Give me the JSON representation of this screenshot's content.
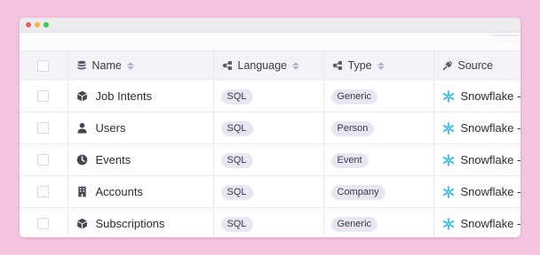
{
  "columns": {
    "name": "Name",
    "language": "Language",
    "type": "Type",
    "source": "Source"
  },
  "rows": [
    {
      "icon": "cube-icon",
      "name": "Job Intents",
      "language": "SQL",
      "type": "Generic",
      "source": "Snowflake -"
    },
    {
      "icon": "person-icon",
      "name": "Users",
      "language": "SQL",
      "type": "Person",
      "source": "Snowflake -"
    },
    {
      "icon": "clock-icon",
      "name": "Events",
      "language": "SQL",
      "type": "Event",
      "source": "Snowflake -"
    },
    {
      "icon": "building-icon",
      "name": "Accounts",
      "language": "SQL",
      "type": "Company",
      "source": "Snowflake -"
    },
    {
      "icon": "cube-icon",
      "name": "Subscriptions",
      "language": "SQL",
      "type": "Generic",
      "source": "Snowflake -"
    }
  ],
  "colors": {
    "background": "#f6c2df",
    "pill": "#e9e6f3",
    "snowflake": "#29b5e8"
  }
}
